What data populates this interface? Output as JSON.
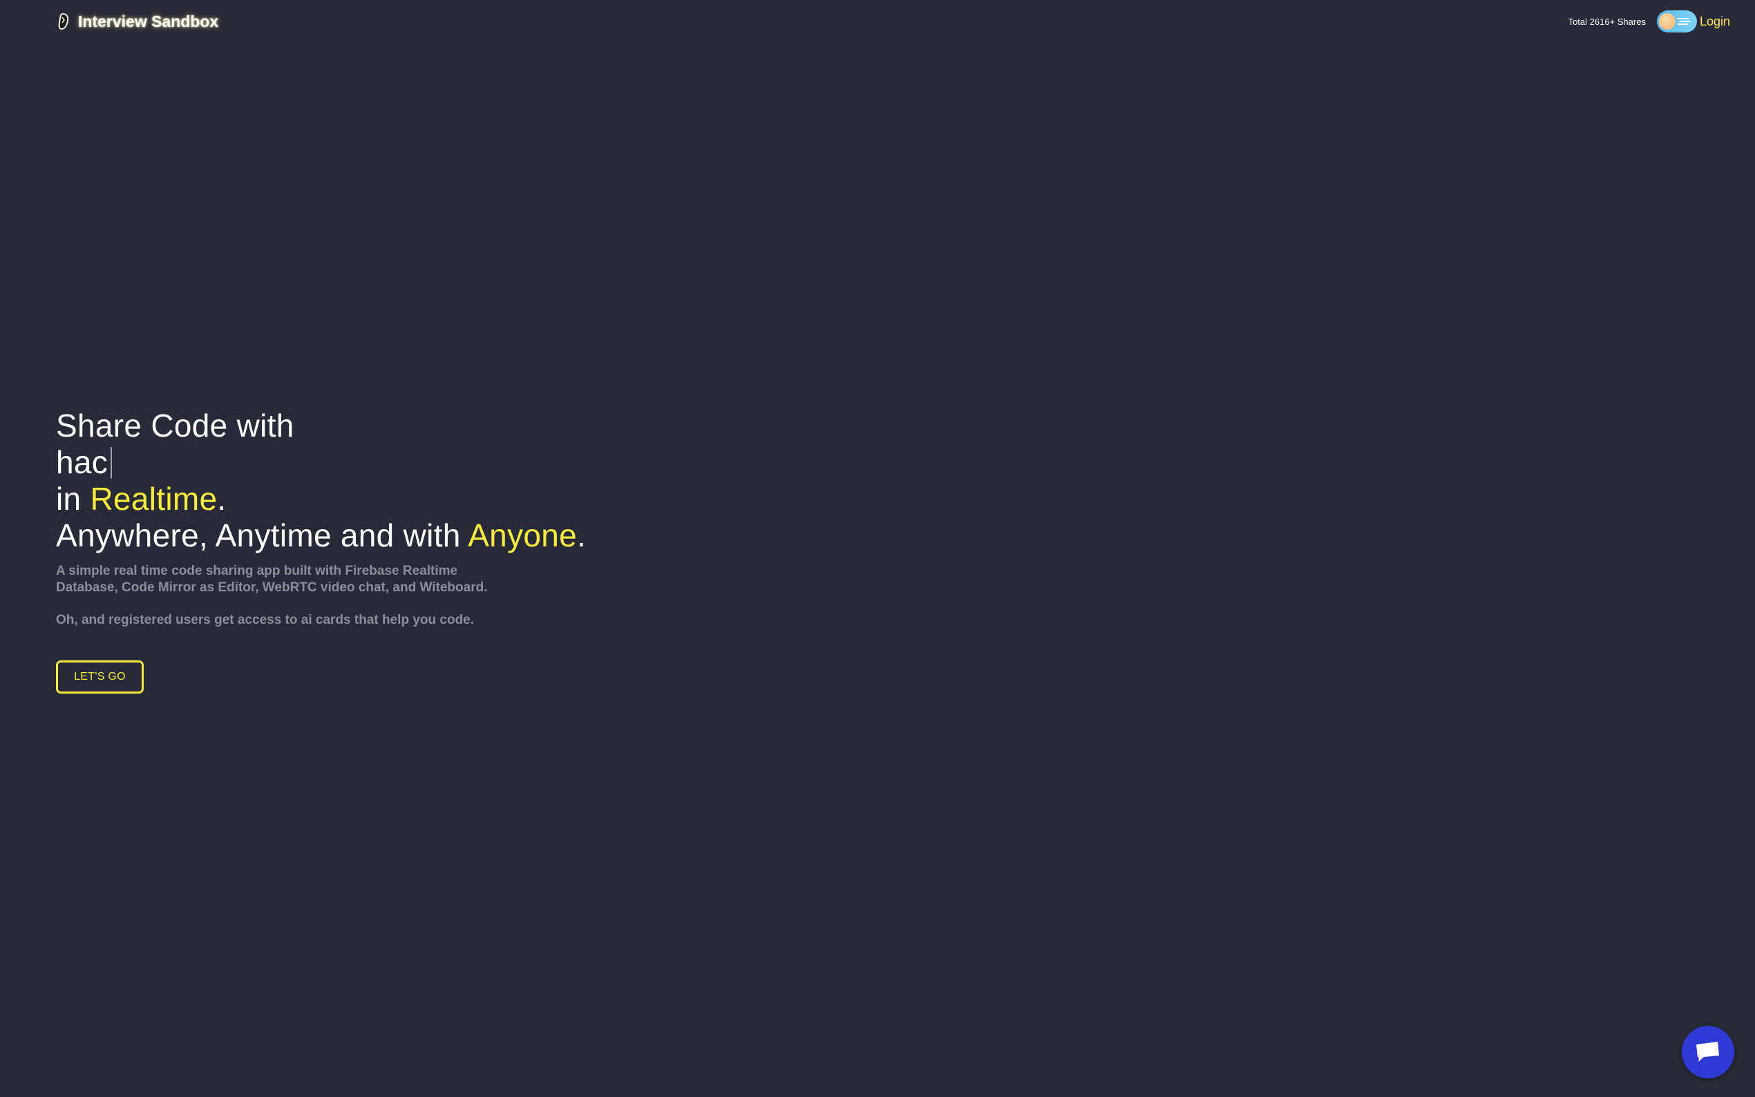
{
  "navbar": {
    "brand_name": "Interview Sandbox",
    "shares_label": "Total 2616+ Shares",
    "login_label": "Login"
  },
  "hero": {
    "line1": "Share Code with",
    "typed_text": "hac",
    "line3_prefix": "in ",
    "line3_accent": "Realtime",
    "line3_suffix": ".",
    "line4_prefix": "Anywhere, Anytime and with ",
    "line4_accent": "Anyone",
    "line4_suffix": ".",
    "description": "A simple real time code sharing app built with Firebase Realtime Database, Code Mirror as Editor, WebRTC video chat, and Witeboard.",
    "description2": "Oh, and registered users get access to ai cards that help you code.",
    "cta_label": "LET'S GO"
  },
  "icons": {
    "brand": "logo-icon",
    "theme_toggle": "sun-cloud-toggle",
    "chat": "chat-icon"
  },
  "colors": {
    "background": "#282a37",
    "accent": "#f5ec3c",
    "muted_text": "#8c8e9c",
    "chat_button": "#2f3ad6",
    "toggle_sky": "#58b9e8"
  }
}
